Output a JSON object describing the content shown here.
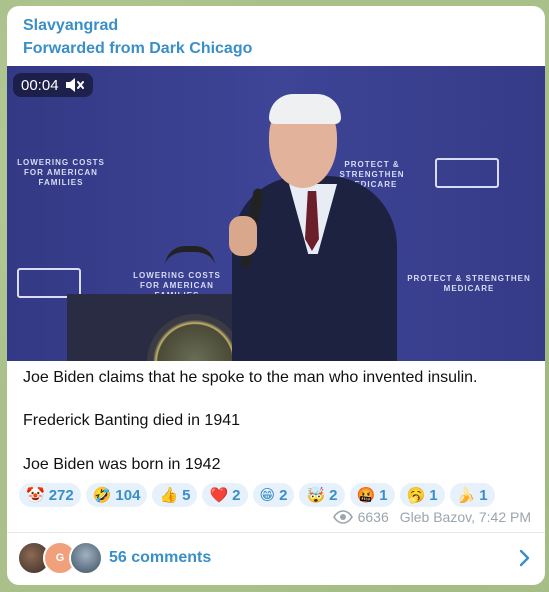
{
  "message": {
    "sender": "Slavyangrad",
    "forwarded": "Forwarded from Dark Chicago",
    "video": {
      "duration": "00:04",
      "muted": true,
      "banners": {
        "left_top": "LOWERING COSTS FOR AMERICAN FAMILIES",
        "right_top": "PROTECT & STRENGTHEN MEDICARE",
        "left_bottom": "LOWERING COSTS FOR AMERICAN FAMILIES",
        "right_bottom": "PROTECT & STRENGTHEN MEDICARE"
      }
    },
    "text": [
      "Joe Biden claims that he spoke to the man who invented insulin.",
      "Frederick Banting died in 1941",
      "Joe Biden was born in 1942"
    ],
    "reactions": [
      {
        "emoji": "🤡",
        "count": "272"
      },
      {
        "emoji": "🤣",
        "count": "104"
      },
      {
        "emoji": "👍",
        "count": "5"
      },
      {
        "emoji": "❤️",
        "count": "2"
      },
      {
        "emoji": "😁",
        "count": "2"
      },
      {
        "emoji": "🤯",
        "count": "2"
      },
      {
        "emoji": "🤬",
        "count": "1"
      },
      {
        "emoji": "🥱",
        "count": "1"
      },
      {
        "emoji": "🍌",
        "count": "1"
      }
    ],
    "views": "6636",
    "signature": "Gleb Bazov, 7:42 PM",
    "comments": {
      "label": "56 comments",
      "avatar_initial": "G"
    }
  },
  "colors": {
    "accent": "#3a8fc7",
    "reaction_bg": "#e6f1fb",
    "meta_gray": "#9aa5ae",
    "background": "#a9c08a"
  }
}
